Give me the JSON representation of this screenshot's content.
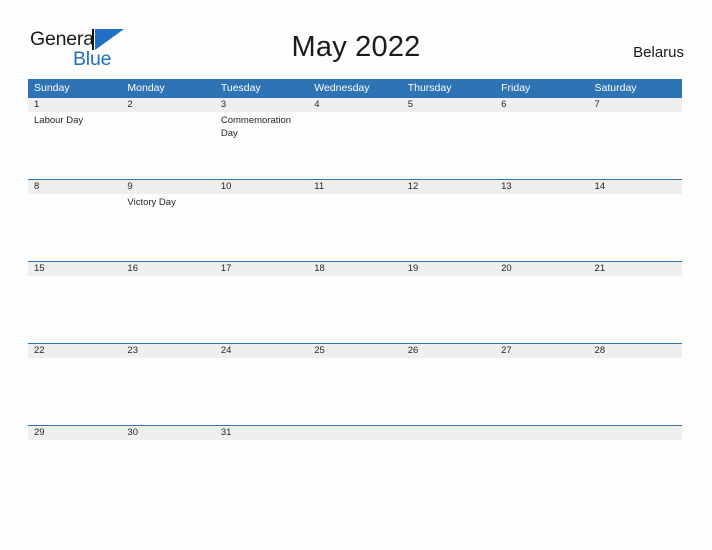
{
  "brand": {
    "name_part1": "General",
    "name_part2": "Blue",
    "flag_color": "#1f6fc4"
  },
  "header": {
    "title": "May 2022",
    "country": "Belarus"
  },
  "colors": {
    "header_blue": "#2e74b5",
    "number_band_gray": "#efefef",
    "page_background": "#fdfdfd",
    "text": "#262626"
  },
  "calendar": {
    "month": "May",
    "year": "2022",
    "day_headers": [
      "Sunday",
      "Monday",
      "Tuesday",
      "Wednesday",
      "Thursday",
      "Friday",
      "Saturday"
    ],
    "weeks": [
      {
        "numbers": [
          "1",
          "2",
          "3",
          "4",
          "5",
          "6",
          "7"
        ],
        "events": [
          "Labour Day",
          "",
          "Commemoration Day",
          "",
          "",
          "",
          ""
        ]
      },
      {
        "numbers": [
          "8",
          "9",
          "10",
          "11",
          "12",
          "13",
          "14"
        ],
        "events": [
          "",
          "Victory Day",
          "",
          "",
          "",
          "",
          ""
        ]
      },
      {
        "numbers": [
          "15",
          "16",
          "17",
          "18",
          "19",
          "20",
          "21"
        ],
        "events": [
          "",
          "",
          "",
          "",
          "",
          "",
          ""
        ]
      },
      {
        "numbers": [
          "22",
          "23",
          "24",
          "25",
          "26",
          "27",
          "28"
        ],
        "events": [
          "",
          "",
          "",
          "",
          "",
          "",
          ""
        ]
      },
      {
        "numbers": [
          "29",
          "30",
          "31",
          "",
          "",
          "",
          ""
        ],
        "events": [
          "",
          "",
          "",
          "",
          "",
          "",
          ""
        ]
      }
    ]
  }
}
